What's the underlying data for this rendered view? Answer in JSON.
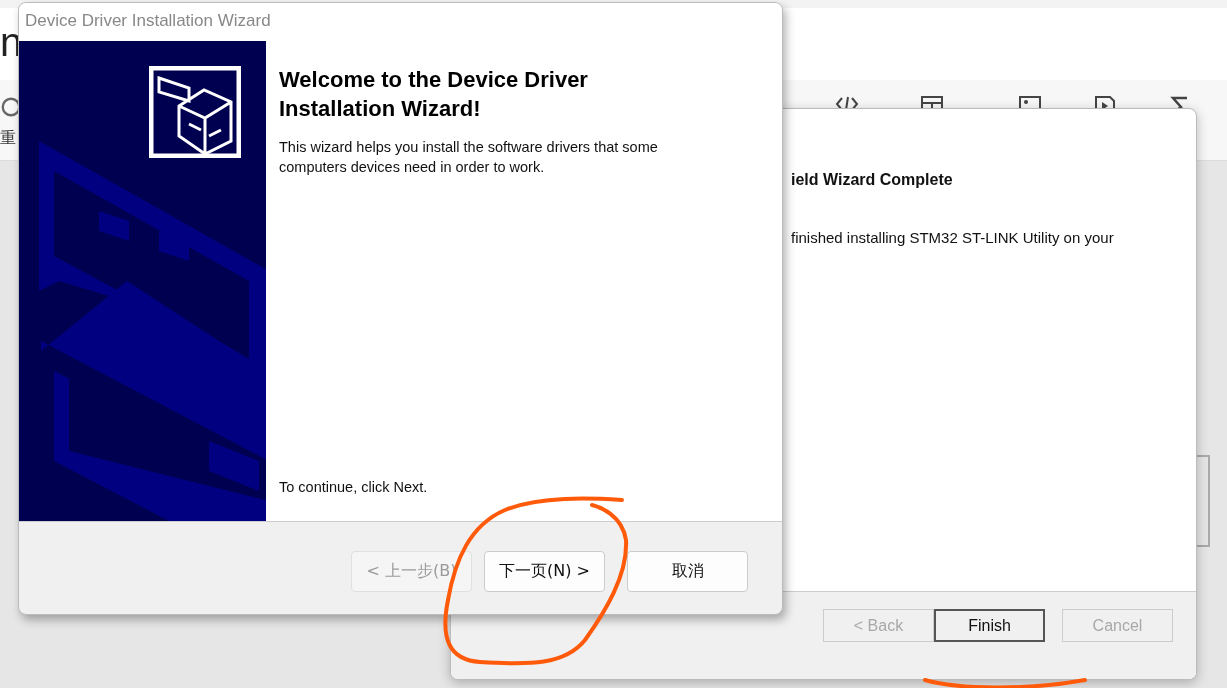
{
  "background_app": {
    "heading_fragment": "n",
    "label_fragment": "重"
  },
  "back_window": {
    "title": "ield Wizard Complete",
    "message": "finished installing STM32 ST-LINK Utility on your",
    "buttons": [
      {
        "label": "< Back",
        "disabled": true,
        "default": false
      },
      {
        "label": "Finish",
        "disabled": false,
        "default": true
      },
      {
        "label": "Cancel",
        "disabled": true,
        "default": false
      }
    ]
  },
  "front_window": {
    "title": "Device Driver Installation Wizard",
    "heading": "Welcome to the Device Driver Installation Wizard!",
    "description": "This wizard helps you install the software drivers that some computers devices need in order to work.",
    "continue_hint": "To continue, click Next.",
    "buttons": [
      {
        "label": "< 上一步(B)",
        "disabled": true
      },
      {
        "label": "下一页(N) >",
        "disabled": false
      },
      {
        "label": "取消",
        "disabled": false
      }
    ]
  }
}
